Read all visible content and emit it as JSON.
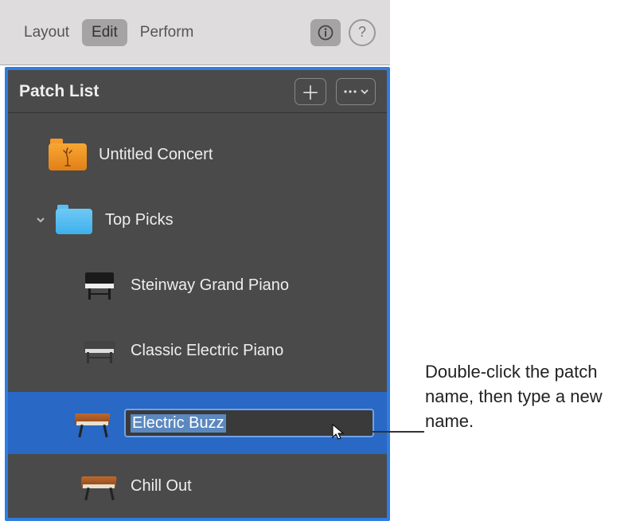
{
  "toolbar": {
    "tabs": [
      "Layout",
      "Edit",
      "Perform"
    ],
    "active_tab": "Edit"
  },
  "panel": {
    "title": "Patch List"
  },
  "tree": {
    "concert": {
      "label": "Untitled Concert"
    },
    "group": {
      "label": "Top Picks"
    },
    "patches": [
      {
        "label": "Steinway Grand Piano",
        "icon": "piano"
      },
      {
        "label": "Classic Electric Piano",
        "icon": "epiano"
      },
      {
        "label": "Electric Buzz",
        "icon": "synth",
        "editing": true
      },
      {
        "label": "Chill Out",
        "icon": "synth"
      }
    ]
  },
  "editing_value": "Electric Buzz",
  "callout": "Double-click the patch name, then type a new name."
}
